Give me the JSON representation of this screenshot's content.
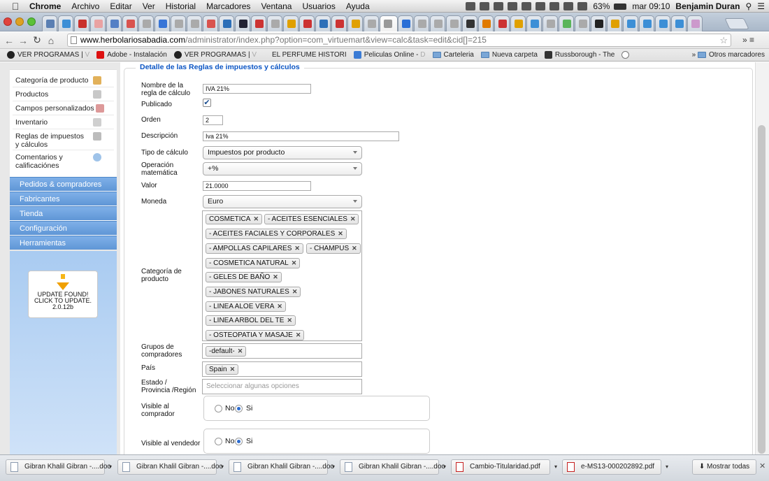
{
  "menubar": {
    "apple": "",
    "items": [
      "Chrome",
      "Archivo",
      "Editar",
      "Ver",
      "Historial",
      "Marcadores",
      "Ventana",
      "Usuarios",
      "Ayuda"
    ],
    "battery": "63%",
    "clock": "mar 09:10",
    "user": "Benjamin Duran"
  },
  "address": {
    "domain": "www.herbolariosabadia.com",
    "path": "/administrator/index.php?option=com_virtuemart&view=calc&task=edit&cid[]=215"
  },
  "bookmarks": [
    {
      "label": "VER PROGRAMAS |",
      "fade": "V"
    },
    {
      "label": "Adobe - Instalación",
      "fade": ""
    },
    {
      "label": "VER PROGRAMAS |",
      "fade": "V"
    },
    {
      "label": "EL PERFUME HISTORI",
      "fade": ""
    },
    {
      "label": "Peliculas Online -",
      "fade": "D"
    },
    {
      "label": "Carteleria",
      "fade": ""
    },
    {
      "label": "Nueva carpeta",
      "fade": ""
    },
    {
      "label": "Russborough - The",
      "fade": ""
    }
  ],
  "bookmarks_other": "Otros marcadores",
  "sidebar": {
    "items": [
      "Categoría de producto",
      "Productos",
      "Campos personalizados",
      "Inventario",
      "Reglas de impuestos y cálculos",
      "Comentarios y calificaciónes"
    ],
    "sections": [
      "Pedidos & compradores",
      "Fabricantes",
      "Tienda",
      "Configuración",
      "Herramientas"
    ],
    "update": {
      "line1": "UPDATE FOUND!",
      "line2": "CLICK TO UPDATE.",
      "line3": "2.0.12b"
    }
  },
  "form": {
    "legend": "Detalle de las Reglas de impuestos y cálculos",
    "name_label": "Nombre de la regla de cálculo",
    "name_value": "IVA 21%",
    "published_label": "Publicado",
    "order_label": "Orden",
    "order_value": "2",
    "desc_label": "Descripción",
    "desc_value": "Iva 21%",
    "calc_type_label": "Tipo de cálculo",
    "calc_type_value": "Impuestos por producto",
    "math_op_label": "Operación matemática",
    "math_op_value": "+%",
    "value_label": "Valor",
    "value_value": "21.0000",
    "currency_label": "Moneda",
    "currency_value": "Euro",
    "category_label": "Categoría de producto",
    "categories": [
      "COSMETICA",
      "- ACEITES ESENCIALES",
      "- ACEITES FACIALES Y CORPORALES",
      "- AMPOLLAS CAPILARES",
      "- CHAMPUS",
      "- COSMETICA NATURAL",
      "- GELES DE BAÑO",
      "- JABONES NATURALES",
      "- LINEA ALOE VERA",
      "- LINEA ARBOL DEL TE",
      "- OSTEOPATIA Y MASAJE"
    ],
    "groups_label": "Grupos de compradores",
    "groups": [
      "-default-"
    ],
    "country_label": "País",
    "countries": [
      "Spain"
    ],
    "state_label": "Estado / Provincia /Región",
    "state_placeholder": "Seleccionar algunas opciones",
    "visible_buyer_label": "Visible al comprador",
    "visible_vendor_label": "Visible al vendedor",
    "no": "No",
    "yes": "Si"
  },
  "downloads": [
    "Gibran Khalil Gibran -....doc",
    "Gibran Khalil Gibran -....doc",
    "Gibran Khalil Gibran -....doc",
    "Gibran Khalil Gibran -....doc",
    "Cambio-Titularidad.pdf",
    "e-MS13-000202892.pdf"
  ],
  "show_all": "Mostrar todas"
}
